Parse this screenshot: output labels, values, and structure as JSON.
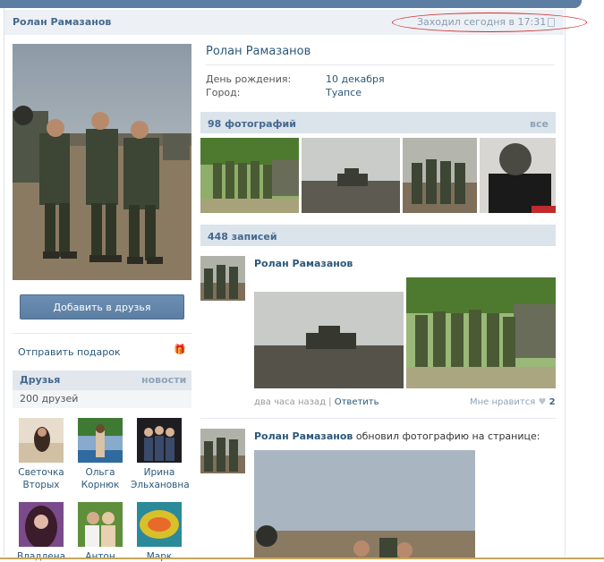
{
  "header": {
    "name": "Ролан Рамазанов",
    "online_status": "Заходил сегодня в 17:31"
  },
  "sidebar": {
    "add_friend": "Добавить в друзья",
    "send_gift": "Отправить подарок",
    "friends_title": "Друзья",
    "friends_news": "новости",
    "friends_count": "200 друзей",
    "friends": [
      {
        "first": "Светочка",
        "last": "Вторых"
      },
      {
        "first": "Ольга",
        "last": "Корнюк"
      },
      {
        "first": "Ирина",
        "last": "Эльхановна"
      },
      {
        "first": "Владлена",
        "last": ""
      },
      {
        "first": "Антон",
        "last": ""
      },
      {
        "first": "Марк",
        "last": ""
      }
    ]
  },
  "profile": {
    "name": "Ролан Рамазанов",
    "birthday_label": "День рождения:",
    "birthday": "10 декабря",
    "city_label": "Город:",
    "city": "Туапсе"
  },
  "photos": {
    "title": "98 фотографий",
    "all": "все"
  },
  "wall": {
    "title": "448 записей",
    "posts": [
      {
        "author": "Ролан Рамазанов",
        "text": "",
        "time": "два часа назад",
        "reply": "Ответить",
        "like_label": "Мне нравится",
        "like_count": "2"
      },
      {
        "author": "Ролан Рамазанов",
        "text": "обновил фотографию на странице:"
      }
    ]
  },
  "colors": {
    "brand": "#5b7ea2",
    "link": "#2b587a",
    "bar": "#dbe3eb",
    "annotation": "#d12a2a"
  }
}
